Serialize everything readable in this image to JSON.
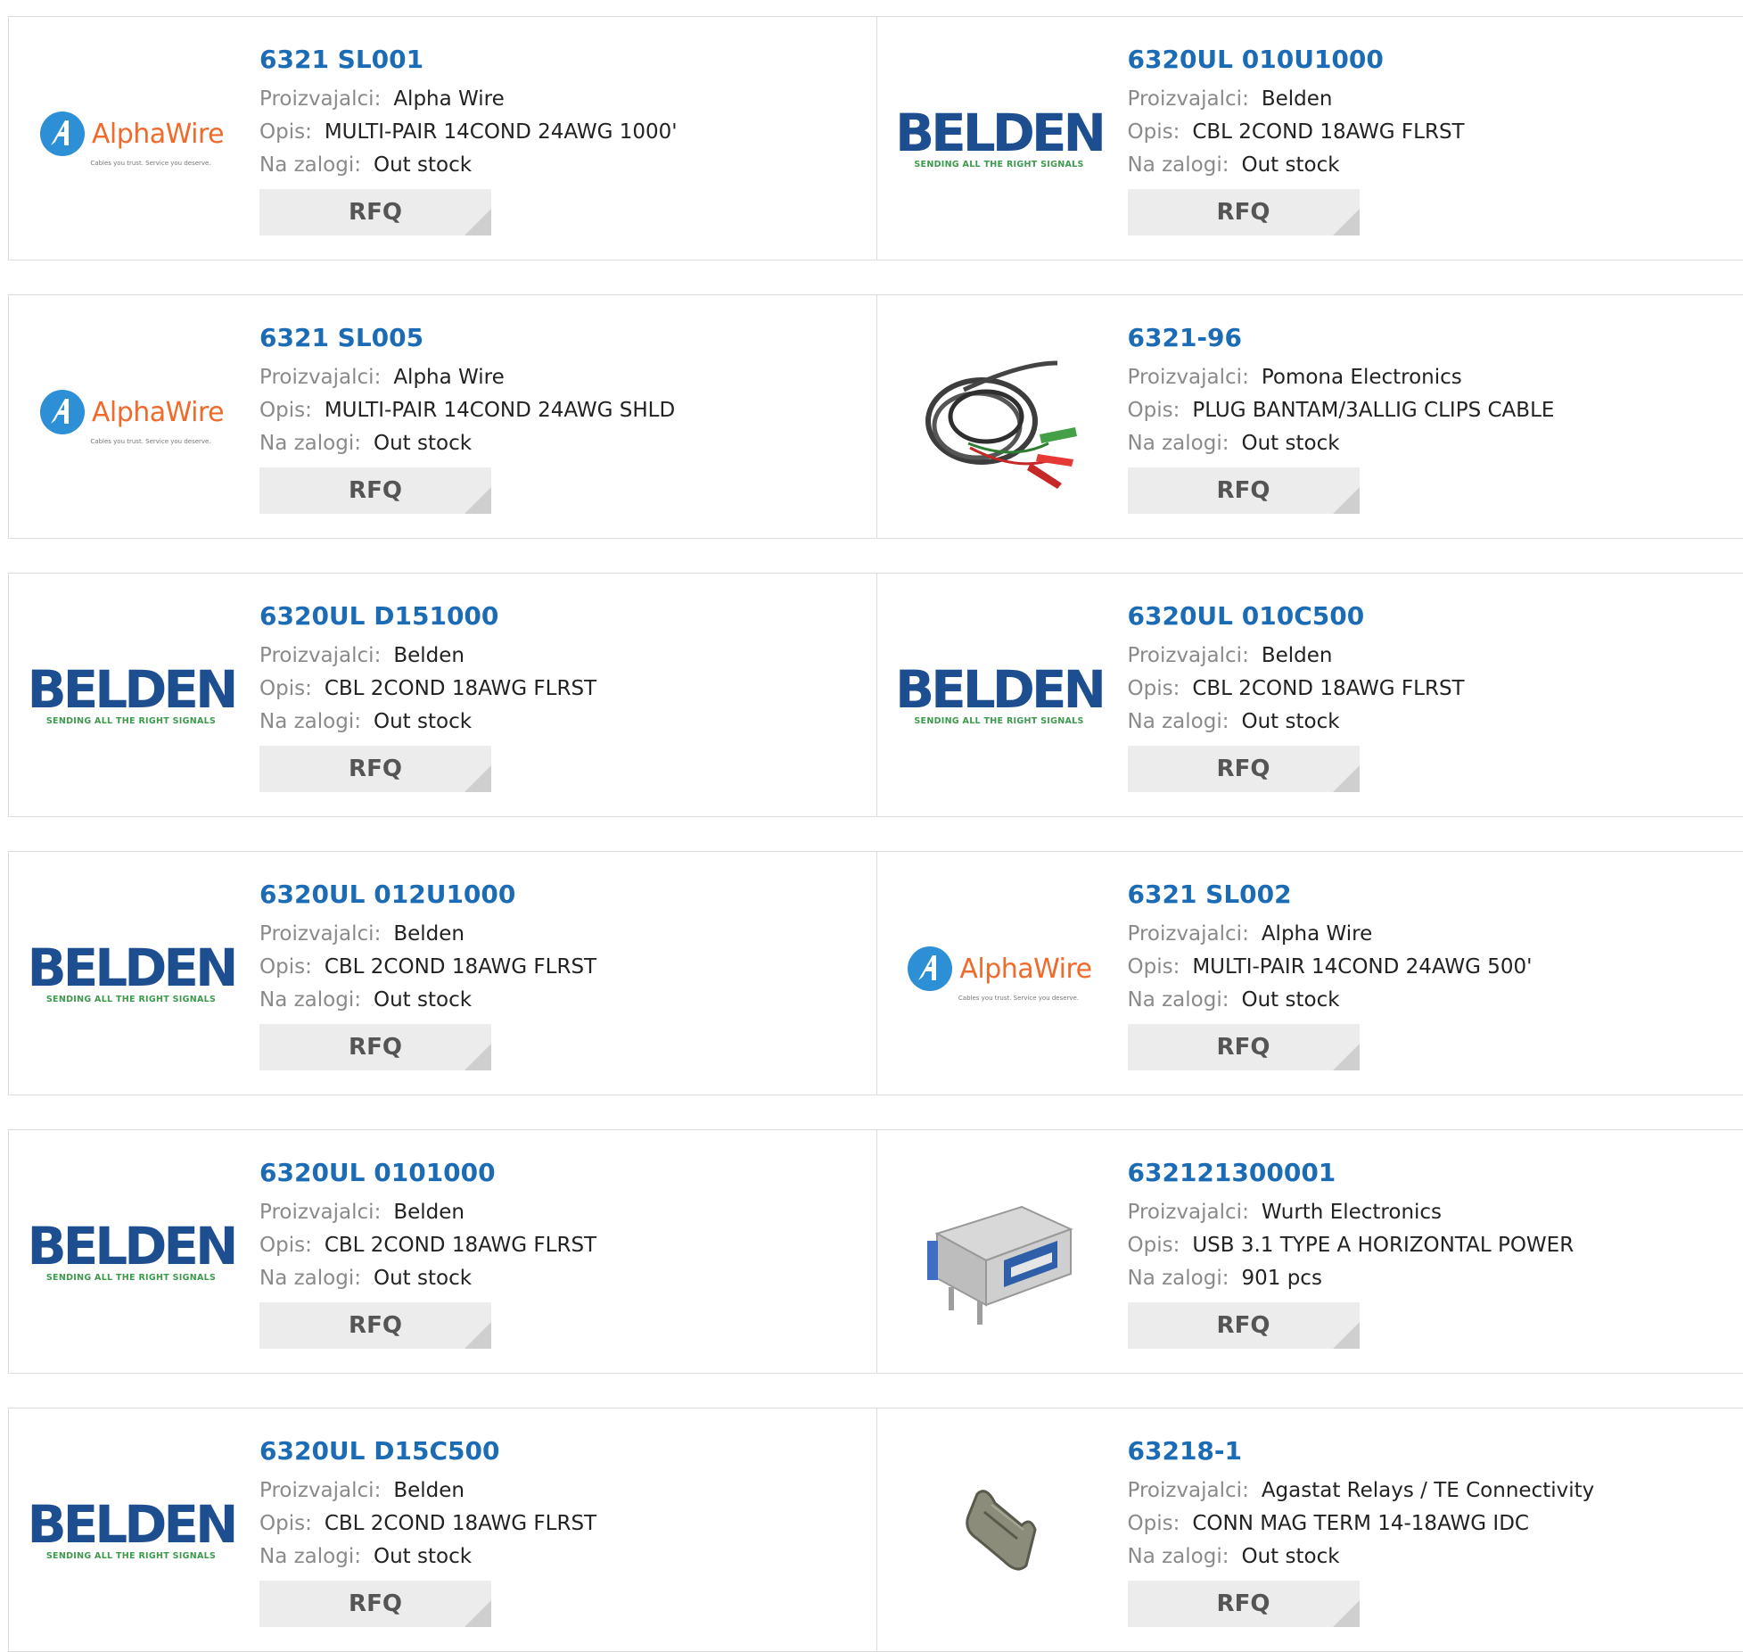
{
  "labels": {
    "manufacturer": "Proizvajalci:",
    "description": "Opis:",
    "stock": "Na zalogi:",
    "rfq": "RFQ"
  },
  "brand_marks": {
    "belden_word": "BELDEN",
    "belden_tag": "SENDING ALL THE RIGHT SIGNALS",
    "alpha_word": "AlphaWire",
    "alpha_tag": "Cables you trust. Service you deserve."
  },
  "colors": {
    "part_link": "#1c6cb5",
    "label_gray": "#8a8a8a",
    "rfq_bg": "#ececec",
    "belden_blue": "#1d4e8f",
    "belden_green": "#3c9a4c",
    "alpha_orange": "#f06a2b",
    "alpha_blue": "#2d8fd5"
  },
  "products": [
    {
      "part": "6321 SL001",
      "manufacturer": "Alpha Wire",
      "description": "MULTI-PAIR 14COND 24AWG 1000'",
      "stock": "Out stock",
      "image": "alphawire-logo-icon"
    },
    {
      "part": "6320UL 010U1000",
      "manufacturer": "Belden",
      "description": "CBL 2COND 18AWG FLRST",
      "stock": "Out stock",
      "image": "belden-logo-icon"
    },
    {
      "part": "6321 SL005",
      "manufacturer": "Alpha Wire",
      "description": "MULTI-PAIR 14COND 24AWG SHLD",
      "stock": "Out stock",
      "image": "alphawire-logo-icon"
    },
    {
      "part": "6321-96",
      "manufacturer": "Pomona Electronics",
      "description": "PLUG BANTAM/3ALLIG CLIPS CABLE",
      "stock": "Out stock",
      "image": "test-lead-cable-icon"
    },
    {
      "part": "6320UL D151000",
      "manufacturer": "Belden",
      "description": "CBL 2COND 18AWG FLRST",
      "stock": "Out stock",
      "image": "belden-logo-icon"
    },
    {
      "part": "6320UL 010C500",
      "manufacturer": "Belden",
      "description": "CBL 2COND 18AWG FLRST",
      "stock": "Out stock",
      "image": "belden-logo-icon"
    },
    {
      "part": "6320UL 012U1000",
      "manufacturer": "Belden",
      "description": "CBL 2COND 18AWG FLRST",
      "stock": "Out stock",
      "image": "belden-logo-icon"
    },
    {
      "part": "6321 SL002",
      "manufacturer": "Alpha Wire",
      "description": "MULTI-PAIR 14COND 24AWG 500'",
      "stock": "Out stock",
      "image": "alphawire-logo-icon"
    },
    {
      "part": "6320UL 0101000",
      "manufacturer": "Belden",
      "description": "CBL 2COND 18AWG FLRST",
      "stock": "Out stock",
      "image": "belden-logo-icon"
    },
    {
      "part": "632121300001",
      "manufacturer": "Wurth Electronics",
      "description": "USB 3.1 TYPE A HORIZONTAL POWER",
      "stock": "901 pcs",
      "image": "usb-connector-icon"
    },
    {
      "part": "6320UL D15C500",
      "manufacturer": "Belden",
      "description": "CBL 2COND 18AWG FLRST",
      "stock": "Out stock",
      "image": "belden-logo-icon"
    },
    {
      "part": "63218-1",
      "manufacturer": "Agastat Relays / TE Connectivity",
      "description": "CONN MAG TERM 14-18AWG IDC",
      "stock": "Out stock",
      "image": "terminal-clip-icon"
    }
  ]
}
